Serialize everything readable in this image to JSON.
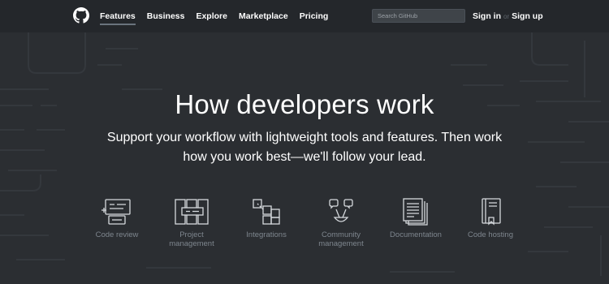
{
  "header": {
    "logo_icon": "github-octocat-icon",
    "nav": [
      {
        "label": "Features",
        "active": true
      },
      {
        "label": "Business",
        "active": false
      },
      {
        "label": "Explore",
        "active": false
      },
      {
        "label": "Marketplace",
        "active": false
      },
      {
        "label": "Pricing",
        "active": false
      }
    ],
    "search_placeholder": "Search GitHub",
    "sign_in": "Sign in",
    "or": "or",
    "sign_up": "Sign up"
  },
  "hero": {
    "title": "How developers work",
    "subtitle_line1": "Support your workflow with lightweight tools and features. Then work",
    "subtitle_line2": "how you work best—we'll follow your lead."
  },
  "features": [
    {
      "icon": "code-review-icon",
      "label_line1": "Code review",
      "label_line2": ""
    },
    {
      "icon": "project-management-icon",
      "label_line1": "Project",
      "label_line2": "management"
    },
    {
      "icon": "integrations-icon",
      "label_line1": "Integrations",
      "label_line2": ""
    },
    {
      "icon": "community-management-icon",
      "label_line1": "Community",
      "label_line2": "management"
    },
    {
      "icon": "documentation-icon",
      "label_line1": "Documentation",
      "label_line2": ""
    },
    {
      "icon": "code-hosting-icon",
      "label_line1": "Code hosting",
      "label_line2": ""
    }
  ],
  "colors": {
    "background": "#2b2e32",
    "header": "#24272b",
    "label": "#7e868e"
  }
}
